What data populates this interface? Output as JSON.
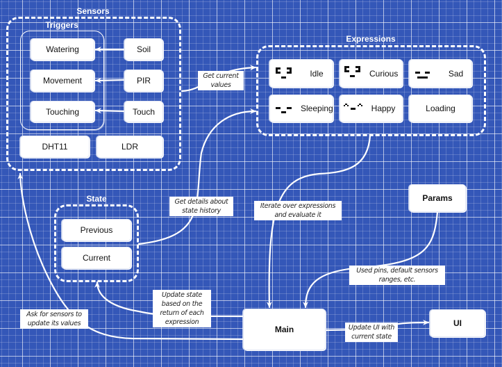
{
  "colors": {
    "background": "#3457b8",
    "grid": "#ffffff",
    "node_fill": "#ffffff",
    "edge": "#ffffff",
    "text": "#111111"
  },
  "groups": {
    "sensors": {
      "title": "Sensors"
    },
    "triggers": {
      "title": "Triggers"
    },
    "expressions": {
      "title": "Expressions"
    },
    "state": {
      "title": "State"
    }
  },
  "triggers": [
    {
      "label": "Watering"
    },
    {
      "label": "Movement"
    },
    {
      "label": "Touching"
    }
  ],
  "sensors": [
    {
      "label": "Soil"
    },
    {
      "label": "PIR"
    },
    {
      "label": "Touch"
    },
    {
      "label": "DHT11"
    },
    {
      "label": "LDR"
    }
  ],
  "expressions": [
    {
      "label": "Idle",
      "face": "idle-face-icon"
    },
    {
      "label": "Curious",
      "face": "curious-face-icon"
    },
    {
      "label": "Sad",
      "face": "sad-face-icon"
    },
    {
      "label": "Sleeping",
      "face": "sleeping-face-icon"
    },
    {
      "label": "Happy",
      "face": "happy-face-icon"
    },
    {
      "label": "Loading",
      "face": null
    }
  ],
  "state": [
    {
      "label": "Previous"
    },
    {
      "label": "Current"
    }
  ],
  "nodes": {
    "params": "Params",
    "main": "Main",
    "ui": "UI"
  },
  "edge_labels": {
    "get_current_values": "Get current values",
    "get_details_state_history": "Get details about state history",
    "iterate_expressions": "Iterate over expressions and evaluate it",
    "params_info": "Used pins, default sensors ranges, etc.",
    "update_state": "Update state based on the return of each expression",
    "ask_sensors": "Ask for sensors to update its values",
    "update_ui": "Update UI with current state"
  }
}
